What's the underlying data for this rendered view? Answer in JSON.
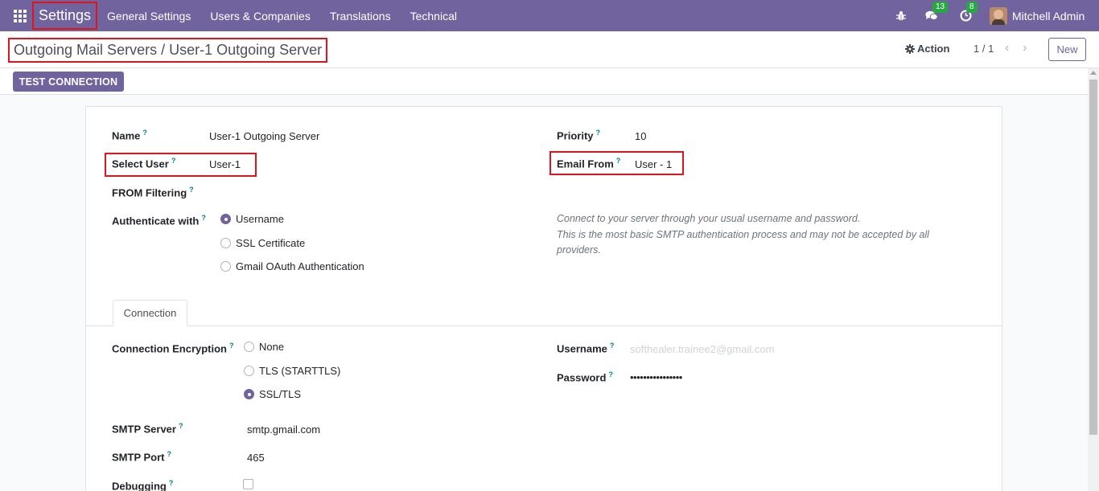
{
  "navbar": {
    "brand": "Settings",
    "menu": [
      "General Settings",
      "Users & Companies",
      "Translations",
      "Technical"
    ],
    "messages_count": "13",
    "activities_count": "8",
    "user_name": "Mitchell Admin"
  },
  "control": {
    "breadcrumb": "Outgoing Mail Servers / User-1 Outgoing Server",
    "action_label": "Action",
    "pager": "1 / 1",
    "new_label": "New"
  },
  "buttons": {
    "test_connection": "TEST CONNECTION"
  },
  "form": {
    "name_label": "Name",
    "name_value": "User-1 Outgoing Server",
    "select_user_label": "Select User",
    "select_user_value": "User-1",
    "from_filtering_label": "FROM Filtering",
    "authenticate_label": "Authenticate with",
    "auth_options": [
      "Username",
      "SSL Certificate",
      "Gmail OAuth Authentication"
    ],
    "auth_selected": "Username",
    "priority_label": "Priority",
    "priority_value": "10",
    "email_from_label": "Email From",
    "email_from_value": "User - 1",
    "auth_help_line1": "Connect to your server through your usual username and password.",
    "auth_help_line2": "This is the most basic SMTP authentication process and may not be accepted by all providers."
  },
  "tabs": [
    "Connection"
  ],
  "connection": {
    "encryption_label": "Connection Encryption",
    "encryption_options": [
      "None",
      "TLS (STARTTLS)",
      "SSL/TLS"
    ],
    "encryption_selected": "SSL/TLS",
    "smtp_server_label": "SMTP Server",
    "smtp_server_value": "smtp.gmail.com",
    "smtp_port_label": "SMTP Port",
    "smtp_port_value": "465",
    "debugging_label": "Debugging",
    "username_label": "Username",
    "username_value": "softhealer.trainee2@gmail.com",
    "password_label": "Password",
    "password_value": "••••••••••••••••"
  },
  "help_mark": "?",
  "colors": {
    "brand": "#71639e",
    "highlight": "#e0141e",
    "help": "#017e84"
  }
}
